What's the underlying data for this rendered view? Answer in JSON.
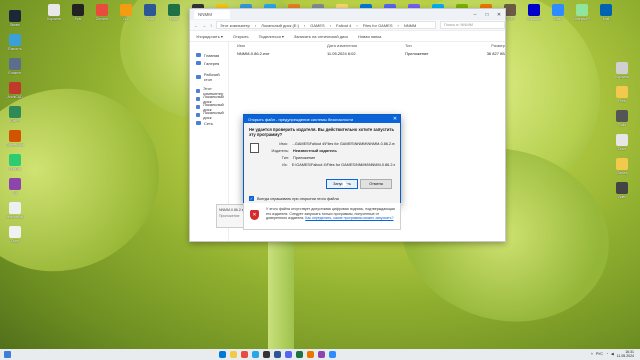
{
  "colors": {
    "accent": "#0a64d8",
    "warning": "#d62b2b",
    "taskbar": "#e9ecef"
  },
  "desktop_left": [
    {
      "label": "Steam",
      "color": "#1b2838"
    },
    {
      "label": "Ёмкость",
      "color": "#3aa0d8"
    },
    {
      "label": "Блокнот",
      "color": "#5c6e8c"
    },
    {
      "label": "ArchiCAD",
      "color": "#c0392b"
    },
    {
      "label": "Ctrl+F",
      "color": "#2e8b57"
    },
    {
      "label": "Screenshot",
      "color": "#d35400"
    },
    {
      "label": "iFunBox",
      "color": "#2ecc71"
    },
    {
      "label": "Tor",
      "color": "#8e44ad"
    },
    {
      "label": "readme.txt",
      "color": "#ecf0f1"
    },
    {
      "label": "Docs",
      "color": "#f1f1f1"
    }
  ],
  "desktop_top": [
    {
      "label": "Корзина",
      "color": "#e8e8e8"
    },
    {
      "label": "Epic",
      "color": "#222222"
    },
    {
      "label": "Chrome",
      "color": "#e74c3c"
    },
    {
      "label": "VLC",
      "color": "#f39c12"
    },
    {
      "label": "Word",
      "color": "#2b5797"
    },
    {
      "label": "Excel",
      "color": "#1e7145"
    },
    {
      "label": "OBS",
      "color": "#333333"
    },
    {
      "label": "Zip",
      "color": "#f1c40f"
    },
    {
      "label": "Photos",
      "color": "#3498db"
    },
    {
      "label": "Telegram",
      "color": "#27a7e7"
    },
    {
      "label": "Paint",
      "color": "#e67e22"
    },
    {
      "label": "Calc",
      "color": "#7f8c8d"
    },
    {
      "label": "Files",
      "color": "#f5d76e"
    },
    {
      "label": "Edge",
      "color": "#0078d7"
    },
    {
      "label": "Discord",
      "color": "#5865f2"
    },
    {
      "label": "Viber",
      "color": "#7360f2"
    },
    {
      "label": "Skype",
      "color": "#00aff0"
    },
    {
      "label": "Torrent",
      "color": "#77b300"
    },
    {
      "label": "Blender",
      "color": "#ea7600"
    },
    {
      "label": "GIMP",
      "color": "#6b5b45"
    },
    {
      "label": "Audacity",
      "color": "#0000cc"
    },
    {
      "label": "Zoom",
      "color": "#2d8cff"
    },
    {
      "label": "Notepad++",
      "color": "#90e59a"
    },
    {
      "label": "Mail",
      "color": "#0063b1"
    }
  ],
  "desktop_right": [
    {
      "label": "Корзина",
      "color": "#d0d0d0"
    },
    {
      "label": "Files",
      "color": "#f2c94c"
    },
    {
      "label": "Tools",
      "color": "#555555"
    },
    {
      "label": "Docs",
      "color": "#e6e6e6"
    },
    {
      "label": "Games",
      "color": "#f2c94c"
    },
    {
      "label": "Video",
      "color": "#444444"
    }
  ],
  "explorer": {
    "tab": "NNMM",
    "path": [
      "Этот компьютер",
      "Локальный диск (E:)",
      "GAMES",
      "Fallout 4",
      "Files for GAMES",
      "NNMM"
    ],
    "search": "Поиск в: NNMM",
    "toolbar": [
      "Упорядочить ▾",
      "Открыть",
      "Поделиться ▾",
      "Записать на оптический диск",
      "Новая папка"
    ],
    "sidebar": [
      "Главная",
      "Галерея",
      "Рабочий стол",
      "Этот компьютер",
      "Локальный диск",
      "Локальный диск",
      "Локальный диск",
      "Сеть"
    ],
    "headers": [
      "Имя",
      "Дата изменения",
      "Тип",
      "Размер"
    ],
    "rows": [
      {
        "name": "NNMM-0.86.2.exe",
        "date": "11.05.2024 6:02",
        "type": "Приложение",
        "size": "36 827 КБ"
      }
    ],
    "preview_name": "NNMM-0.86.2.exe",
    "preview_type": "Приложение"
  },
  "dialog": {
    "title": "Открыть файл - предупреждение системы безопасности",
    "question": "Не удается проверить издателя. Вы действительно хотите запустить эту программу?",
    "labels": {
      "name": "Имя:",
      "publisher": "Издатель:",
      "type": "Тип:",
      "from": "Из:"
    },
    "values": {
      "name": "...GAMES\\Fallout 4\\Files for GAMES\\NNMM\\NNMM-0.86.2.exe",
      "publisher": "Неизвестный издатель",
      "type": "Приложение",
      "from": "E:\\GAMES\\Fallout 4\\Files for GAMES\\NNMM\\NNMM-0.86.2.e..."
    },
    "run": "Запустить",
    "cancel": "Отмена",
    "checkbox": "Всегда спрашивать при открытии этого файла",
    "warning": "У этого файла отсутствует допустимая цифровая подпись, подтверждающая его издателя. Следует запускать только программы, полученные от доверенного издателя.",
    "warning_link": "Как определить, какие программы можно запускать?"
  },
  "taskbar": {
    "apps": [
      "#0078d7",
      "#f2c94c",
      "#e74c3c",
      "#27a7e7",
      "#333333",
      "#2b5797",
      "#5865f2",
      "#1e7145",
      "#ea7600",
      "#8e44ad",
      "#2d8cff"
    ],
    "lang": "РУС",
    "time": "16:31",
    "date": "11.05.2024"
  }
}
